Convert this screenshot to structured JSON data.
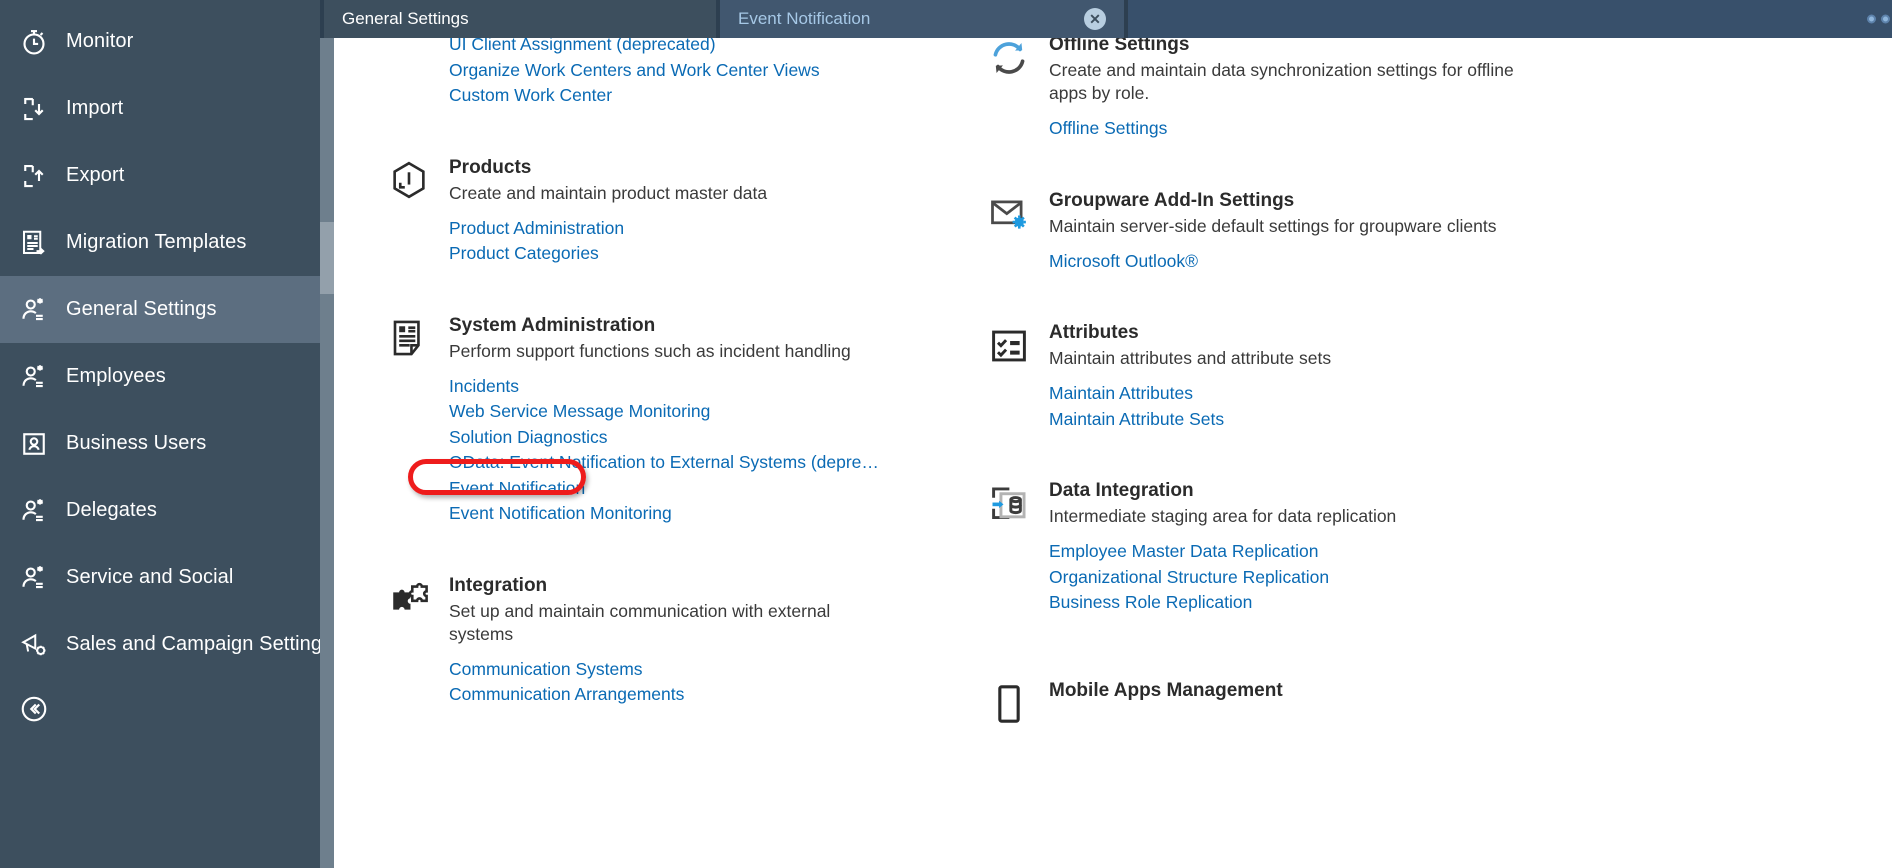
{
  "sidebar": {
    "items": [
      {
        "label": "Monitor",
        "icon": "stopwatch-icon",
        "active": false
      },
      {
        "label": "Import",
        "icon": "file-download-icon",
        "active": false
      },
      {
        "label": "Export",
        "icon": "file-upload-icon",
        "active": false
      },
      {
        "label": "Migration Templates",
        "icon": "migration-template-icon",
        "active": false
      },
      {
        "label": "General Settings",
        "icon": "user-star-icon",
        "active": true
      },
      {
        "label": "Employees",
        "icon": "user-star-icon",
        "active": false
      },
      {
        "label": "Business Users",
        "icon": "user-card-icon",
        "active": false
      },
      {
        "label": "Delegates",
        "icon": "user-star-icon",
        "active": false
      },
      {
        "label": "Service and Social",
        "icon": "user-star-icon",
        "active": false
      },
      {
        "label": "Sales and Campaign Settings",
        "icon": "megaphone-gear-icon",
        "active": false
      }
    ],
    "collapse_label": "collapse-sidebar-icon"
  },
  "tabs": [
    {
      "label": "General Settings",
      "active": true,
      "closable": false
    },
    {
      "label": "Event Notification",
      "active": false,
      "closable": true,
      "close_glyph": "✕"
    }
  ],
  "colors": {
    "sidebar_bg": "#3d4f5e",
    "sidebar_active": "#5c6e80",
    "tabbar_bg": "#38506b",
    "link": "#0a6ab4",
    "annotation": "#ee1c1c"
  },
  "left_column": {
    "orphan_links": [
      "UI Client Assignment (deprecated)",
      "Organize Work Centers and Work Center Views",
      "Custom Work Center"
    ],
    "tiles": [
      {
        "title": "Products",
        "desc": "Create and maintain product master data",
        "icon": "cube-icon",
        "links": [
          "Product Administration",
          "Product Categories"
        ]
      },
      {
        "title": "System Administration",
        "desc": "Perform support functions such as incident handling",
        "icon": "document-list-icon",
        "links": [
          "Incidents",
          "Web Service Message Monitoring",
          "Solution Diagnostics",
          "OData: Event Notification to External Systems (depre…",
          "Event Notification",
          "Event Notification Monitoring"
        ],
        "highlighted_link": "Event Notification"
      },
      {
        "title": "Integration",
        "desc": "Set up and maintain communication with external systems",
        "icon": "puzzle-icon",
        "links": [
          "Communication Systems",
          "Communication Arrangements"
        ]
      }
    ]
  },
  "right_column": {
    "tiles": [
      {
        "title": "Offline Settings",
        "desc": "Create and maintain data synchronization settings for offline apps by role.",
        "icon": "sync-icon",
        "links": [
          "Offline Settings"
        ]
      },
      {
        "title": "Groupware Add-In Settings",
        "desc": "Maintain server-side default settings for groupware clients",
        "icon": "mail-gear-icon",
        "links": [
          "Microsoft Outlook®"
        ]
      },
      {
        "title": "Attributes",
        "desc": "Maintain attributes and attribute sets",
        "icon": "checklist-icon",
        "links": [
          "Maintain Attributes",
          "Maintain Attribute Sets"
        ]
      },
      {
        "title": "Data Integration",
        "desc": "Intermediate staging area for data replication",
        "icon": "data-staging-icon",
        "links": [
          "Employee Master Data Replication",
          "Organizational Structure Replication",
          "Business Role Replication"
        ]
      },
      {
        "title": "Mobile Apps Management",
        "desc": "",
        "icon": "mobile-icon",
        "links": []
      }
    ]
  }
}
